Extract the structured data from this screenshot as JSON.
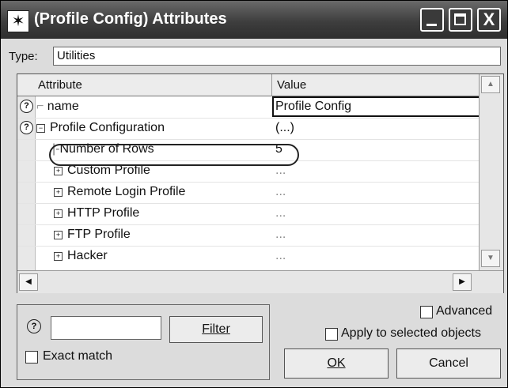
{
  "window": {
    "title": "(Profile Config) Attributes",
    "controls": {
      "minimize": "_",
      "maximize": "□",
      "close": "X"
    }
  },
  "type_row": {
    "label": "Type:",
    "value": "Utilities"
  },
  "grid": {
    "headers": {
      "attribute": "Attribute",
      "value": "Value"
    },
    "rows": [
      {
        "attribute": "name",
        "value": "Profile Config",
        "help": "?"
      },
      {
        "attribute": "Profile Configuration",
        "value": "(...)",
        "help": "?"
      },
      {
        "attribute": "Number of Rows",
        "value": "5"
      },
      {
        "attribute": "Custom Profile",
        "value": "..."
      },
      {
        "attribute": "Remote Login Profile",
        "value": "..."
      },
      {
        "attribute": "HTTP Profile",
        "value": "..."
      },
      {
        "attribute": "FTP Profile",
        "value": "..."
      },
      {
        "attribute": "Hacker",
        "value": "..."
      }
    ]
  },
  "filter": {
    "help": "?",
    "input_value": "",
    "button_label": "Filter",
    "exact_match_label": "Exact match"
  },
  "options": {
    "advanced_label": "Advanced",
    "apply_label": "Apply to selected objects"
  },
  "buttons": {
    "ok": "OK",
    "cancel": "Cancel"
  },
  "colors": {
    "titlebar": "#3e3e3e",
    "window_bg": "#dcdcdc"
  }
}
